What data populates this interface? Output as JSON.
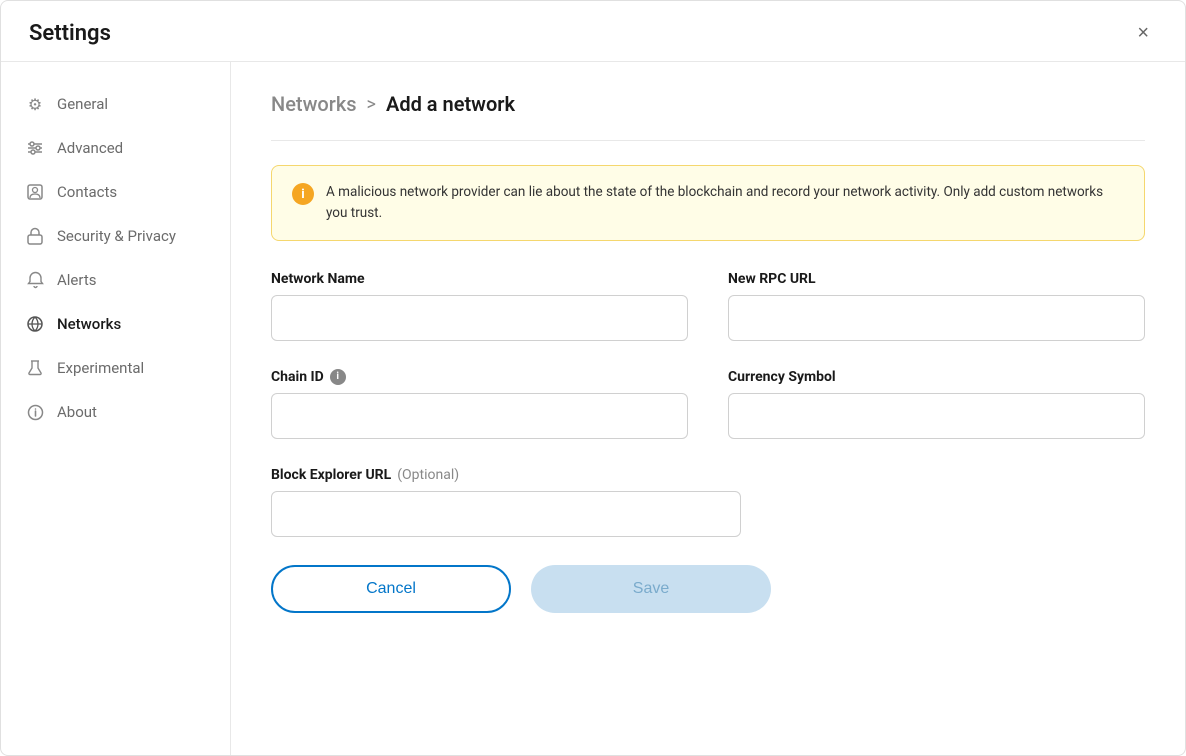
{
  "window": {
    "title": "Settings",
    "close_label": "×"
  },
  "sidebar": {
    "items": [
      {
        "id": "general",
        "label": "General",
        "icon": "⚙"
      },
      {
        "id": "advanced",
        "label": "Advanced",
        "icon": "≡"
      },
      {
        "id": "contacts",
        "label": "Contacts",
        "icon": "▣"
      },
      {
        "id": "security-privacy",
        "label": "Security & Privacy",
        "icon": "🔒"
      },
      {
        "id": "alerts",
        "label": "Alerts",
        "icon": "🔔"
      },
      {
        "id": "networks",
        "label": "Networks",
        "icon": "🔧"
      },
      {
        "id": "experimental",
        "label": "Experimental",
        "icon": "⚗"
      },
      {
        "id": "about",
        "label": "About",
        "icon": "ℹ"
      }
    ]
  },
  "breadcrumb": {
    "parent": "Networks",
    "separator": ">",
    "current": "Add a network"
  },
  "warning": {
    "icon": "i",
    "text": "A malicious network provider can lie about the state of the blockchain and record your network activity. Only add custom networks you trust."
  },
  "form": {
    "network_name_label": "Network Name",
    "new_rpc_url_label": "New RPC URL",
    "chain_id_label": "Chain ID",
    "chain_id_info": "i",
    "currency_symbol_label": "Currency Symbol",
    "block_explorer_url_label": "Block Explorer URL",
    "block_explorer_url_optional": "(Optional)"
  },
  "buttons": {
    "cancel": "Cancel",
    "save": "Save"
  }
}
